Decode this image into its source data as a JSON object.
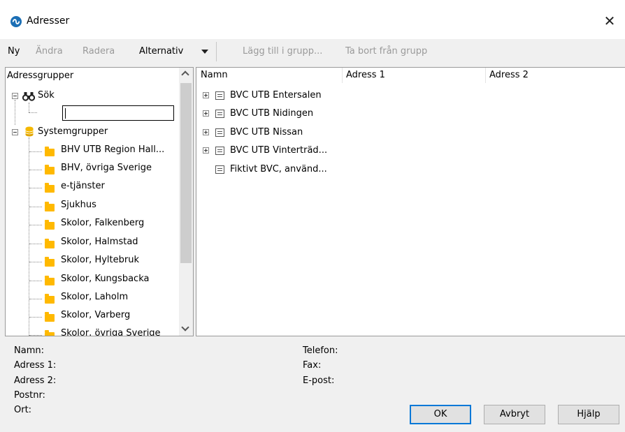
{
  "window": {
    "title": "Adresser",
    "close_glyph": "✕"
  },
  "toolbar": {
    "new": "Ny",
    "edit": "Ändra",
    "delete": "Radera",
    "options": "Alternativ",
    "add_to_group": "Lägg till i grupp...",
    "remove_from_group": "Ta bort från grupp"
  },
  "tree": {
    "header": "Adressgrupper",
    "search_label": "Sök",
    "search_value": "",
    "system_groups_label": "Systemgrupper",
    "groups": [
      "BHV UTB Region Hall...",
      "BHV, övriga Sverige",
      "e-tjänster",
      "Sjukhus",
      "Skolor, Falkenberg",
      "Skolor, Halmstad",
      "Skolor, Hyltebruk",
      "Skolor, Kungsbacka",
      "Skolor, Laholm",
      "Skolor, Varberg",
      "Skolor, övriga Sverige"
    ]
  },
  "list": {
    "columns": [
      "Namn",
      "Adress 1",
      "Adress 2"
    ],
    "rows": [
      "BVC UTB Entersalen",
      "BVC UTB Nidingen",
      "BVC UTB Nissan",
      "BVC UTB Vinterträd...",
      "Fiktivt BVC, använd..."
    ]
  },
  "details": {
    "name": "Namn:",
    "address1": "Adress 1:",
    "address2": "Adress 2:",
    "postcode": "Postnr:",
    "city": "Ort:",
    "phone": "Telefon:",
    "fax": "Fax:",
    "email": "E-post:"
  },
  "buttons": {
    "ok": "OK",
    "cancel": "Avbryt",
    "help": "Hjälp"
  },
  "colors": {
    "folder": "#ffb900",
    "db": "#f5b800",
    "accent": "#0078d7"
  }
}
